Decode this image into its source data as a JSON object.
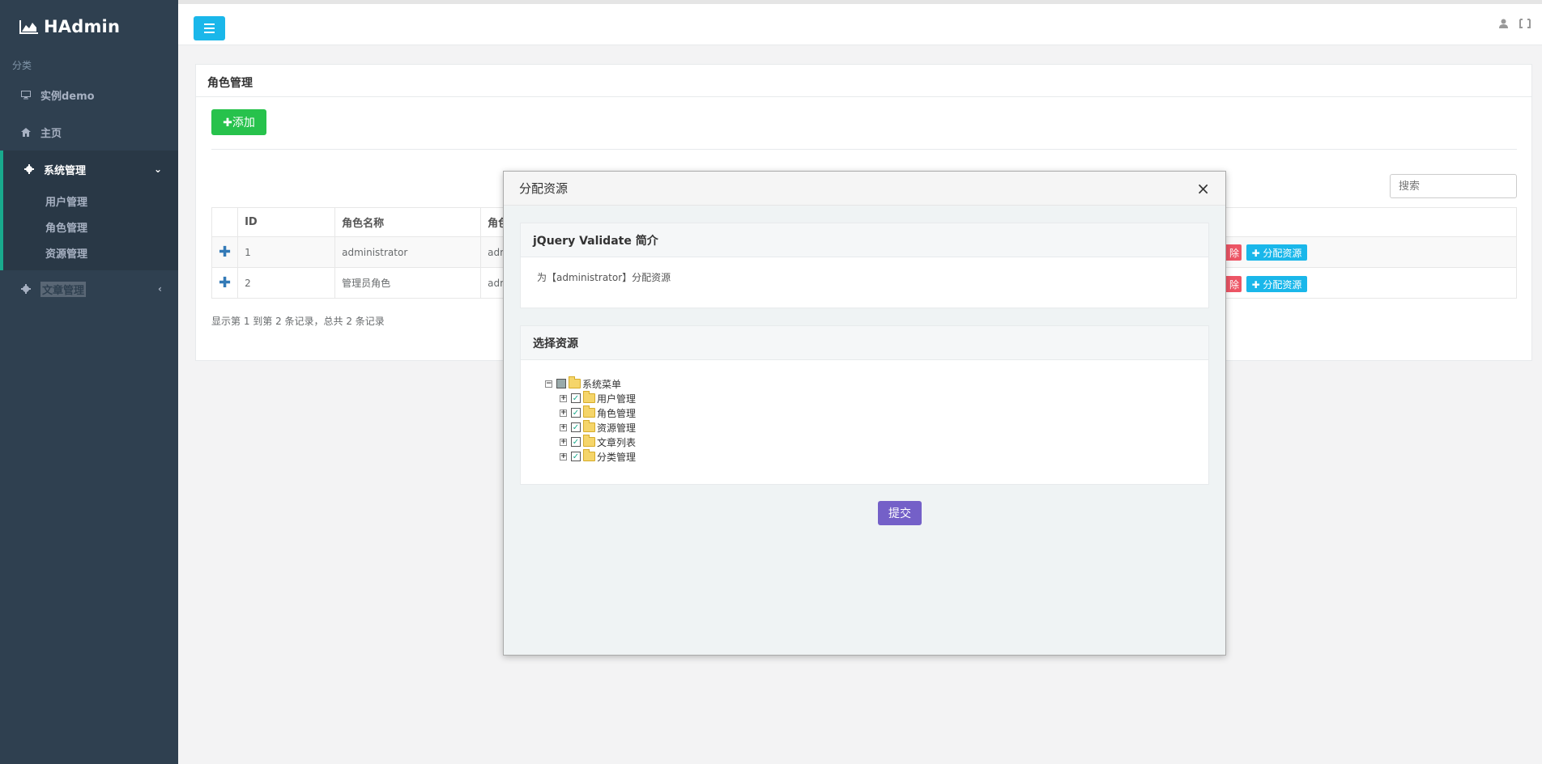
{
  "sidebar": {
    "brand": "HAdmin",
    "header": "分类",
    "items": [
      {
        "label": "实例demo",
        "icon": "monitor-icon"
      },
      {
        "label": "主页",
        "icon": "home-icon"
      },
      {
        "label": "系统管理",
        "icon": "gear-icon"
      },
      {
        "label": "文章管理",
        "icon": "gear-icon"
      }
    ],
    "submenu": [
      "用户管理",
      "角色管理",
      "资源管理"
    ]
  },
  "page": {
    "title": "角色管理",
    "add_label": "✚添加",
    "search_placeholder": "搜索",
    "columns": [
      "ID",
      "角色名称",
      "角色"
    ],
    "rows": [
      {
        "id": "1",
        "name": "administrator",
        "partial": "adm"
      },
      {
        "id": "2",
        "name": "管理员角色",
        "partial": "adm"
      }
    ],
    "delete_label": "除",
    "assign_label": "✚ 分配资源",
    "footer": "显示第 1 到第 2 条记录，总共 2 条记录"
  },
  "modal": {
    "title": "分配资源",
    "close": "×",
    "intro_title": "jQuery Validate 简介",
    "intro_text": "为【administrator】分配资源",
    "select_title": "选择资源",
    "tree_root": "系统菜单",
    "tree_children": [
      "用户管理",
      "角色管理",
      "资源管理",
      "文章列表",
      "分类管理"
    ],
    "submit": "提交"
  },
  "colors": {
    "sidebar_bg": "#2f4050",
    "accent_active": "#19aa8d",
    "btn_info": "#1ab7ea",
    "btn_success": "#27c24c",
    "btn_danger": "#ed5565",
    "btn_submit": "#7460c8"
  }
}
